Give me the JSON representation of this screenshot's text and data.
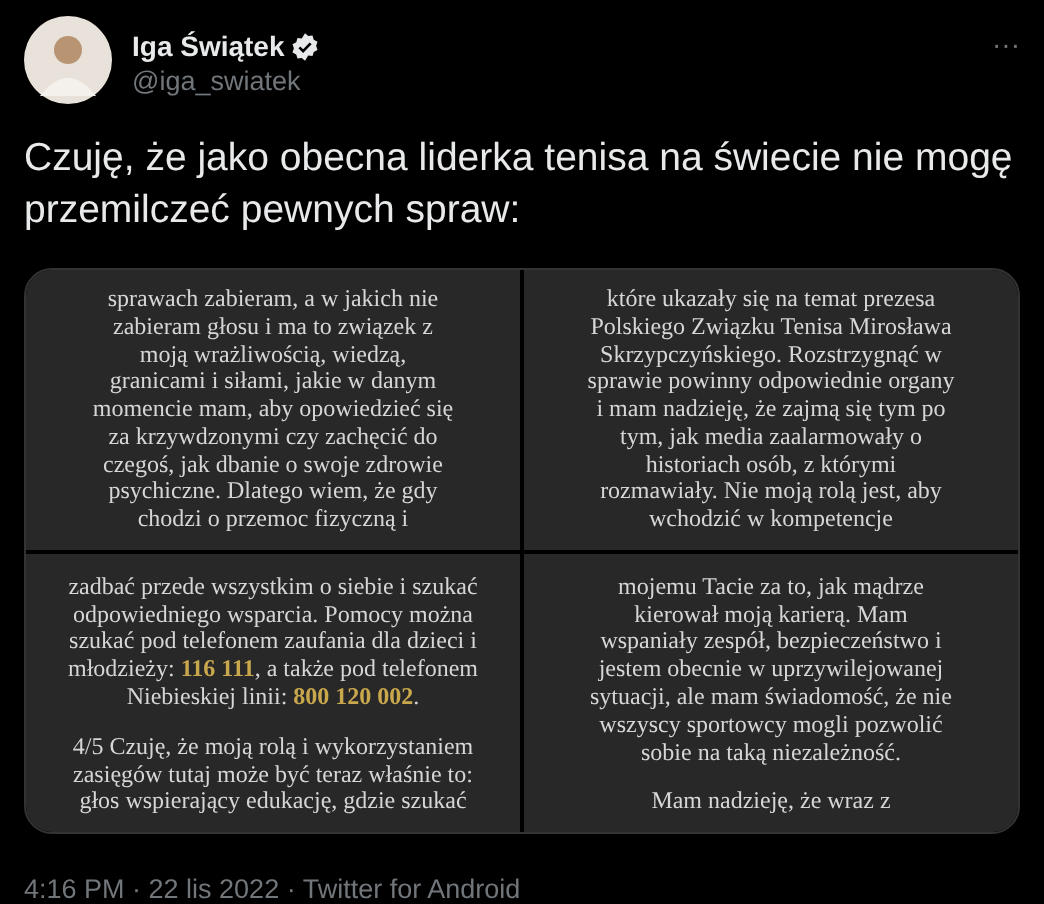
{
  "author": {
    "name": "Iga Świątek",
    "handle": "@iga_swiatek",
    "verified": true,
    "more": "···"
  },
  "text": "Czuję, że jako obecna liderka tenisa na świecie nie mogę przemilczeć pewnych spraw:",
  "images": [
    {
      "paragraphs": [
        [
          "sprawach zabieram, a w jakich nie",
          "zabieram głosu i ma to związek z",
          "moją wrażliwością, wiedzą,",
          "granicami i siłami, jakie w danym",
          "momencie mam, aby opowiedzieć się",
          "za krzywdzonymi czy zachęcić do",
          "czegoś, jak dbanie o swoje zdrowie",
          "psychiczne. Dlatego wiem, że gdy",
          "chodzi o przemoc fizyczną i"
        ]
      ]
    },
    {
      "paragraphs": [
        [
          "które ukazały się na temat prezesa",
          "Polskiego Związku Tenisa Mirosława",
          "Skrzypczyńskiego. Rozstrzygnąć w",
          "sprawie powinny odpowiednie organy",
          "i mam nadzieję, że zajmą się tym po",
          "tym, jak media zaalarmowały o",
          "historiach osób, z którymi",
          "rozmawiały. Nie moją rolą jest, aby",
          "wchodzić w kompetencje"
        ]
      ]
    },
    {
      "paragraphs": [
        [
          "zadbać przede wszystkim o siebie i szukać",
          "odpowiedniego wsparcia. Pomocy można",
          "szukać pod telefonem zaufania dla dzieci i",
          [
            {
              "text": "młodzieży: ",
              "highlight": false
            },
            {
              "text": "116 111",
              "highlight": true
            },
            {
              "text": ", a także pod telefonem",
              "highlight": false
            }
          ],
          [
            {
              "text": "Niebieskiej linii: ",
              "highlight": false
            },
            {
              "text": "800 120 002",
              "highlight": true
            },
            {
              "text": ".",
              "highlight": false
            }
          ]
        ],
        [
          "4/5 Czuję, że moją rolą i wykorzystaniem",
          "zasięgów tutaj może być teraz właśnie to:",
          "głos wspierający edukację, gdzie szukać"
        ]
      ]
    },
    {
      "paragraphs": [
        [
          "mojemu Tacie za to, jak mądrze",
          "kierował moją karierą. Mam",
          "wspaniały zespół, bezpieczeństwo i",
          "jestem obecnie w uprzywilejowanej",
          "sytuacji, ale mam świadomość, że nie",
          "wszyscy sportowcy mogli pozwolić",
          "sobie na taką niezależność."
        ],
        [
          "Mam nadzieję, że wraz z"
        ]
      ]
    }
  ],
  "footer": "4:16 PM · 22 lis 2022 · Twitter for Android"
}
